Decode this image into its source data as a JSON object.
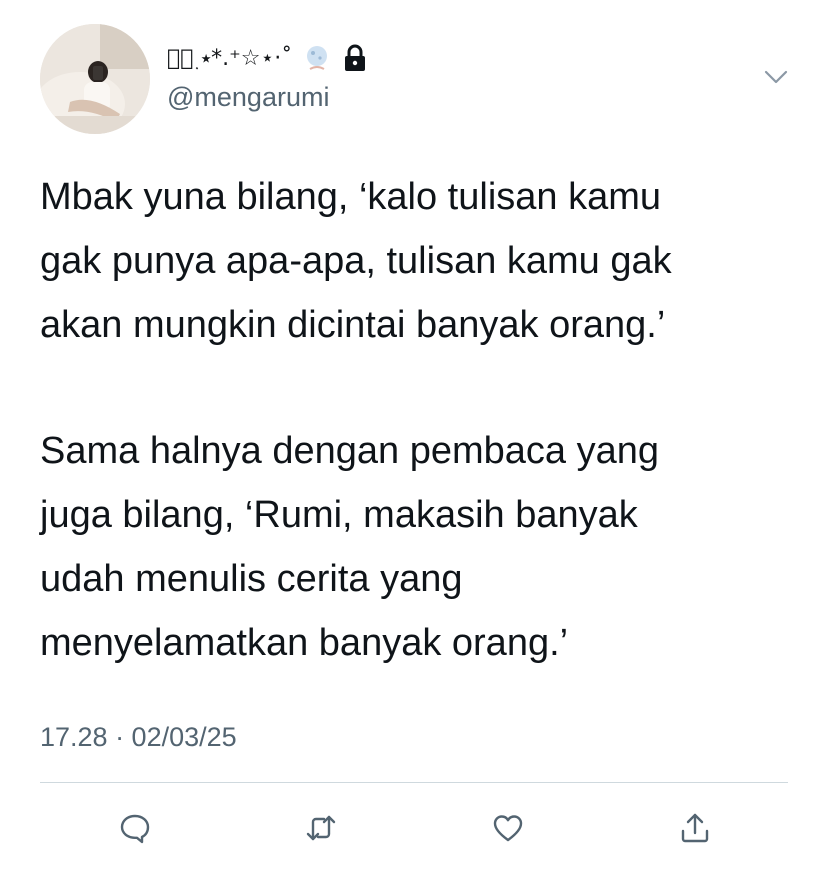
{
  "author": {
    "display_name": "⭒๋࣭ ⭑*.⁺☆⋆·˚",
    "handle": "@mengarumi",
    "protected": true,
    "icons": [
      "avatar",
      "moon-icon",
      "lock-icon"
    ]
  },
  "tweet": {
    "paragraph1": [
      "Mbak yuna bilang, ‘kalo tulisan kamu",
      "gak punya apa-apa, tulisan kamu gak",
      "akan mungkin dicintai banyak orang.’"
    ],
    "paragraph2": [
      "Sama halnya dengan pembaca yang",
      "juga bilang, ‘Rumi, makasih banyak",
      "udah menulis cerita yang",
      "menyelamatkan banyak orang.’"
    ],
    "timestamp": "17.28 · 02/03/25"
  },
  "actions": [
    "reply-icon",
    "retweet-icon",
    "like-icon",
    "share-icon"
  ],
  "colors": {
    "text": "#0f1419",
    "secondary": "#536471",
    "divider": "#cfd9de"
  }
}
